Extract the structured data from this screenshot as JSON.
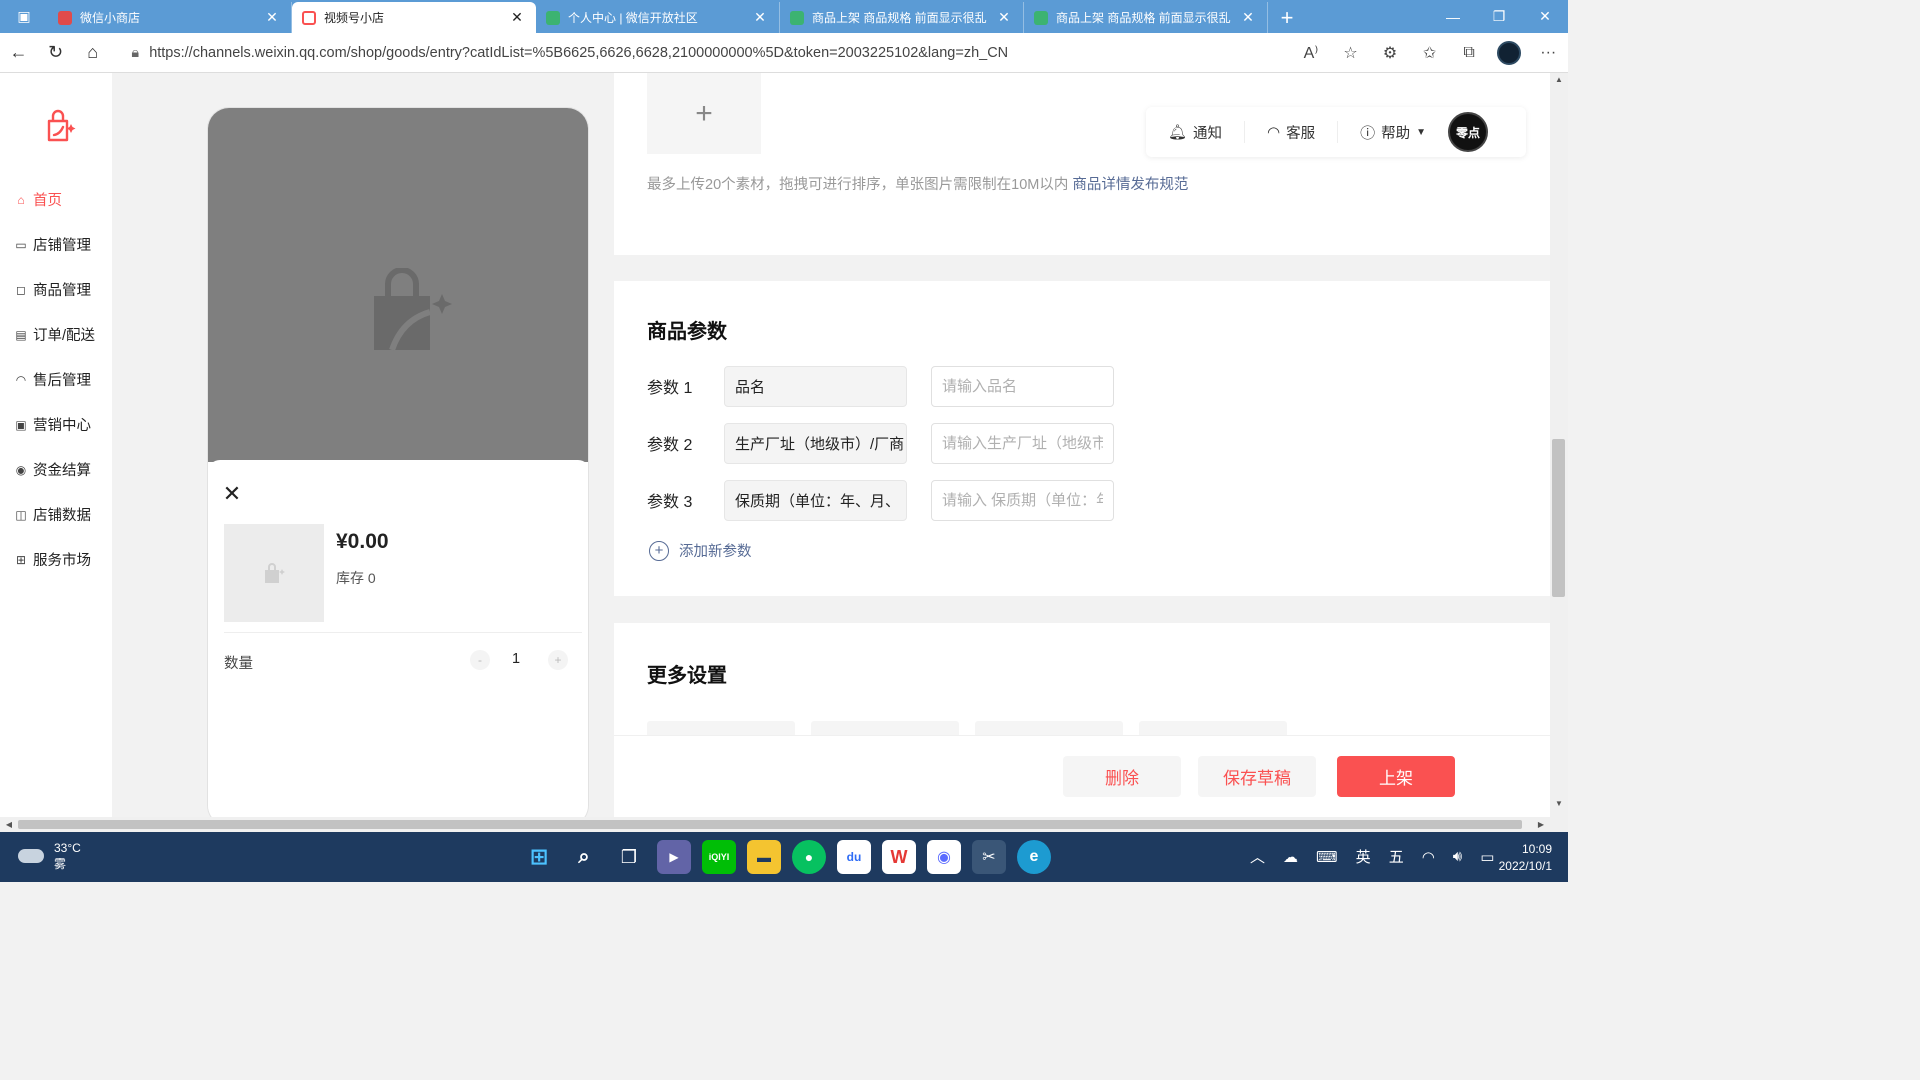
{
  "browser": {
    "tabs": [
      {
        "label": "微信小商店",
        "active": false,
        "color": "#e04b4b"
      },
      {
        "label": "视频号小店",
        "active": true,
        "color": "#fa5151"
      },
      {
        "label": "个人中心 | 微信开放社区",
        "active": false,
        "color": "#3cb371"
      },
      {
        "label": "商品上架 商品规格 前面显示很乱",
        "active": false,
        "color": "#3cb371"
      },
      {
        "label": "商品上架 商品规格 前面显示很乱",
        "active": false,
        "color": "#3cb371"
      }
    ],
    "url": "https://channels.weixin.qq.com/shop/goods/entry?catIdList=%5B6625,6626,6628,2100000000%5D&token=2003225102&lang=zh_CN",
    "accent": "#5b9bd5"
  },
  "sidebar": {
    "items": [
      {
        "label": "首页",
        "icon": "home-icon",
        "active": true
      },
      {
        "label": "店铺管理",
        "icon": "store-icon",
        "active": false
      },
      {
        "label": "商品管理",
        "icon": "bag-icon",
        "active": false
      },
      {
        "label": "订单/配送",
        "icon": "order-icon",
        "active": false
      },
      {
        "label": "售后管理",
        "icon": "headset-icon",
        "active": false
      },
      {
        "label": "营销中心",
        "icon": "coupon-icon",
        "active": false
      },
      {
        "label": "资金结算",
        "icon": "money-icon",
        "active": false
      },
      {
        "label": "店铺数据",
        "icon": "chart-icon",
        "active": false
      },
      {
        "label": "服务市场",
        "icon": "grid-icon",
        "active": false
      }
    ]
  },
  "header": {
    "notify": "通知",
    "service": "客服",
    "help": "帮助",
    "avatar_text": "零点"
  },
  "preview": {
    "price": "¥0.00",
    "stock": "库存 0",
    "qty_label": "数量",
    "qty_value": "1",
    "qty_minus": "-",
    "qty_plus": "+"
  },
  "upload": {
    "plus": "+",
    "hint": "最多上传20个素材，拖拽可进行排序，单张图片需限制在10M以内",
    "link": "商品详情发布规范"
  },
  "params": {
    "title": "商品参数",
    "rows": [
      {
        "label": "参数 1",
        "name": "品名",
        "placeholder": "请输入品名"
      },
      {
        "label": "参数 2",
        "name": "生产厂址（地级市）/厂商",
        "placeholder": "请输入生产厂址（地级市）"
      },
      {
        "label": "参数 3",
        "name": "保质期（单位：年、月、",
        "placeholder": "请输入 保质期（单位：年"
      }
    ],
    "add_label": "添加新参数"
  },
  "more": {
    "title": "更多设置"
  },
  "actions": {
    "delete": "删除",
    "draft": "保存草稿",
    "publish": "上架"
  },
  "taskbar": {
    "temp": "33°C",
    "weather": "雾",
    "ime_lang": "英",
    "ime_mode": "五",
    "time": "10:09",
    "date": "2022/10/1"
  },
  "colors": {
    "brand_red": "#fa5151",
    "link_blue": "#576b95"
  }
}
